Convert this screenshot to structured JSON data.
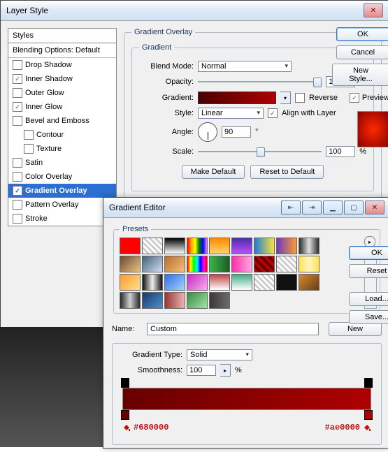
{
  "layerStyle": {
    "title": "Layer Style",
    "stylesHeader": "Styles",
    "blendingDefault": "Blending Options: Default",
    "items": [
      {
        "label": "Drop Shadow",
        "checked": false
      },
      {
        "label": "Inner Shadow",
        "checked": true
      },
      {
        "label": "Outer Glow",
        "checked": false
      },
      {
        "label": "Inner Glow",
        "checked": true
      },
      {
        "label": "Bevel and Emboss",
        "checked": false
      },
      {
        "label": "Contour",
        "checked": false,
        "indent": true
      },
      {
        "label": "Texture",
        "checked": false,
        "indent": true
      },
      {
        "label": "Satin",
        "checked": false
      },
      {
        "label": "Color Overlay",
        "checked": false
      },
      {
        "label": "Gradient Overlay",
        "checked": true,
        "active": true
      },
      {
        "label": "Pattern Overlay",
        "checked": false
      },
      {
        "label": "Stroke",
        "checked": false
      }
    ],
    "section": "Gradient Overlay",
    "subsection": "Gradient",
    "blendModeLabel": "Blend Mode:",
    "blendMode": "Normal",
    "opacityLabel": "Opacity:",
    "opacity": "100",
    "pct": "%",
    "gradientLabel": "Gradient:",
    "reverse": "Reverse",
    "styleLabel": "Style:",
    "styleVal": "Linear",
    "align": "Align with Layer",
    "angleLabel": "Angle:",
    "angle": "90",
    "deg": "°",
    "scaleLabel": "Scale:",
    "scale": "100",
    "makeDefault": "Make Default",
    "resetDefault": "Reset to Default",
    "ok": "OK",
    "cancel": "Cancel",
    "newStyle": "New Style...",
    "previewLabel": "Preview"
  },
  "gradEditor": {
    "title": "Gradient Editor",
    "presets": "Presets",
    "ok": "OK",
    "reset": "Reset",
    "load": "Load...",
    "save": "Save...",
    "nameLabel": "Name:",
    "name": "Custom",
    "new": "New",
    "typeLabel": "Gradient Type:",
    "type": "Solid",
    "smoothLabel": "Smoothness:",
    "smooth": "100",
    "pct": "%",
    "hexLeft": "#680000",
    "hexRight": "#ae0000",
    "swatches": [
      "linear-gradient(#ff0000,#ff0000)",
      "linear-gradient(45deg,#ccc 25%,#fff 25%,#fff 50%,#ccc 50%,#ccc 75%,#fff 75%)",
      "linear-gradient(#000,#fff)",
      "linear-gradient(90deg,red,orange,yellow,green,blue,violet)",
      "linear-gradient(#ff8a00,#ffd36b)",
      "linear-gradient(#4a2fa3,#c04dff)",
      "linear-gradient(90deg,#1e7dd4,#ffe13b)",
      "linear-gradient(90deg,#6d3ac1,#ff9a2e)",
      "linear-gradient(90deg,#2e2e2e,#e0e0e0 50%,#2e2e2e)",
      "linear-gradient(135deg,#6d4a2c,#e6c189)",
      "linear-gradient(135deg,#44617a,#cfe0ec)",
      "linear-gradient(135deg,#b76e2d,#f2c07a)",
      "linear-gradient(90deg,red,yellow,lime,cyan,blue,magenta,red)",
      "linear-gradient(90deg,#3bb54a,#1a5c24)",
      "linear-gradient(90deg,#ff2ea6,#ffa9e0)",
      "repeating-linear-gradient(45deg,#b00,#b00 4px,#600 4px,#600 8px)",
      "linear-gradient(45deg,#ccc 25%,#fff 25%,#fff 50%,#ccc 50%,#ccc 75%,#fff 75%)",
      "linear-gradient(90deg,#ffe258,#fff6c0 50%,#ffe258)",
      "linear-gradient(135deg,#ff9a2e,#ffe089)",
      "linear-gradient(90deg,#111,#eee 50%,#111)",
      "linear-gradient(135deg,#2f6fe6,#a7d2ff)",
      "linear-gradient(135deg,#c12abf,#ffa9f4)",
      "linear-gradient(#b44,#fff)",
      "linear-gradient(#4a8,#fff)",
      "linear-gradient(45deg,#ccc 25%,#fff 25%,#fff 50%,#ccc 50%,#ccc 75%,#fff 75%)",
      "linear-gradient(#111,#111)",
      "linear-gradient(135deg,#d48a34,#6b3d12)",
      "linear-gradient(90deg,#2a2a2a,#cfcfcf 50%,#2a2a2a)",
      "linear-gradient(135deg,#173a6b,#4f8fd1)",
      "linear-gradient(90deg,#9a3434,#e9b4b4)",
      "linear-gradient(135deg,#3a8a41,#9fe6a6)",
      "linear-gradient(90deg,#3a3a3a,#6a6a6a)"
    ]
  }
}
